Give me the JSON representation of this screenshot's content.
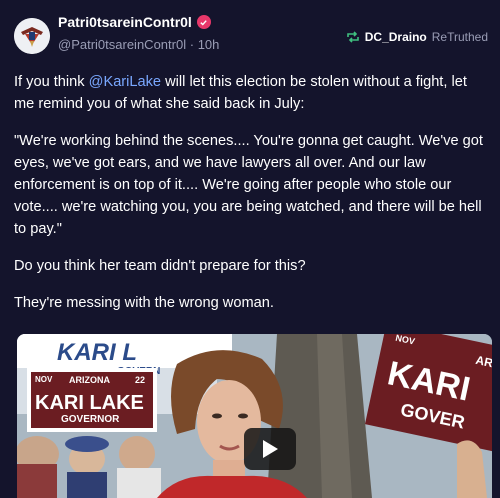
{
  "header": {
    "display_name": "Patri0tsareinContr0l",
    "handle": "@Patri0tsareinContr0l",
    "separator": "·",
    "time": "10h",
    "retruth_user": "DC_Draino",
    "retruth_label": "ReTruthed"
  },
  "post": {
    "p1_before": "If you think ",
    "p1_mention": "@KariLake",
    "p1_after": " will let this election be stolen without a fight, let me remind you of what she said back in July:",
    "p2": "\"We're working behind the scenes.... You're gonna get caught. We've got eyes, we've got ears, and we have lawyers all over. And our law enforcement is on top of it.... We're going after people who stole our vote.... we're watching you, you are being watched, and there will be hell to pay.\"",
    "p3": "Do you think her team didn't prepare for this?",
    "p4": "They're messing with the wrong woman."
  },
  "media": {
    "sign_left_top": "NOV",
    "sign_left_state": "ARIZONA",
    "sign_left_day": "22",
    "sign_left_name": "KARI LAKE",
    "sign_left_role": "GOVERNOR",
    "sign_right_top": "NOV",
    "sign_right_state": "AR",
    "sign_right_name": "KARI",
    "sign_right_role": "GOVER",
    "banner_text": "KARI L",
    "banner_sub": "GOVERN"
  },
  "colors": {
    "background": "#14142c",
    "mention": "#7aa8ff",
    "verified": "#e8376a",
    "retruth_icon": "#3fbf7f",
    "sign_maroon": "#6b1d22"
  },
  "icons": {
    "verified": "verified-badge-icon",
    "retruth": "retruth-arrows-icon",
    "play": "play-icon"
  }
}
